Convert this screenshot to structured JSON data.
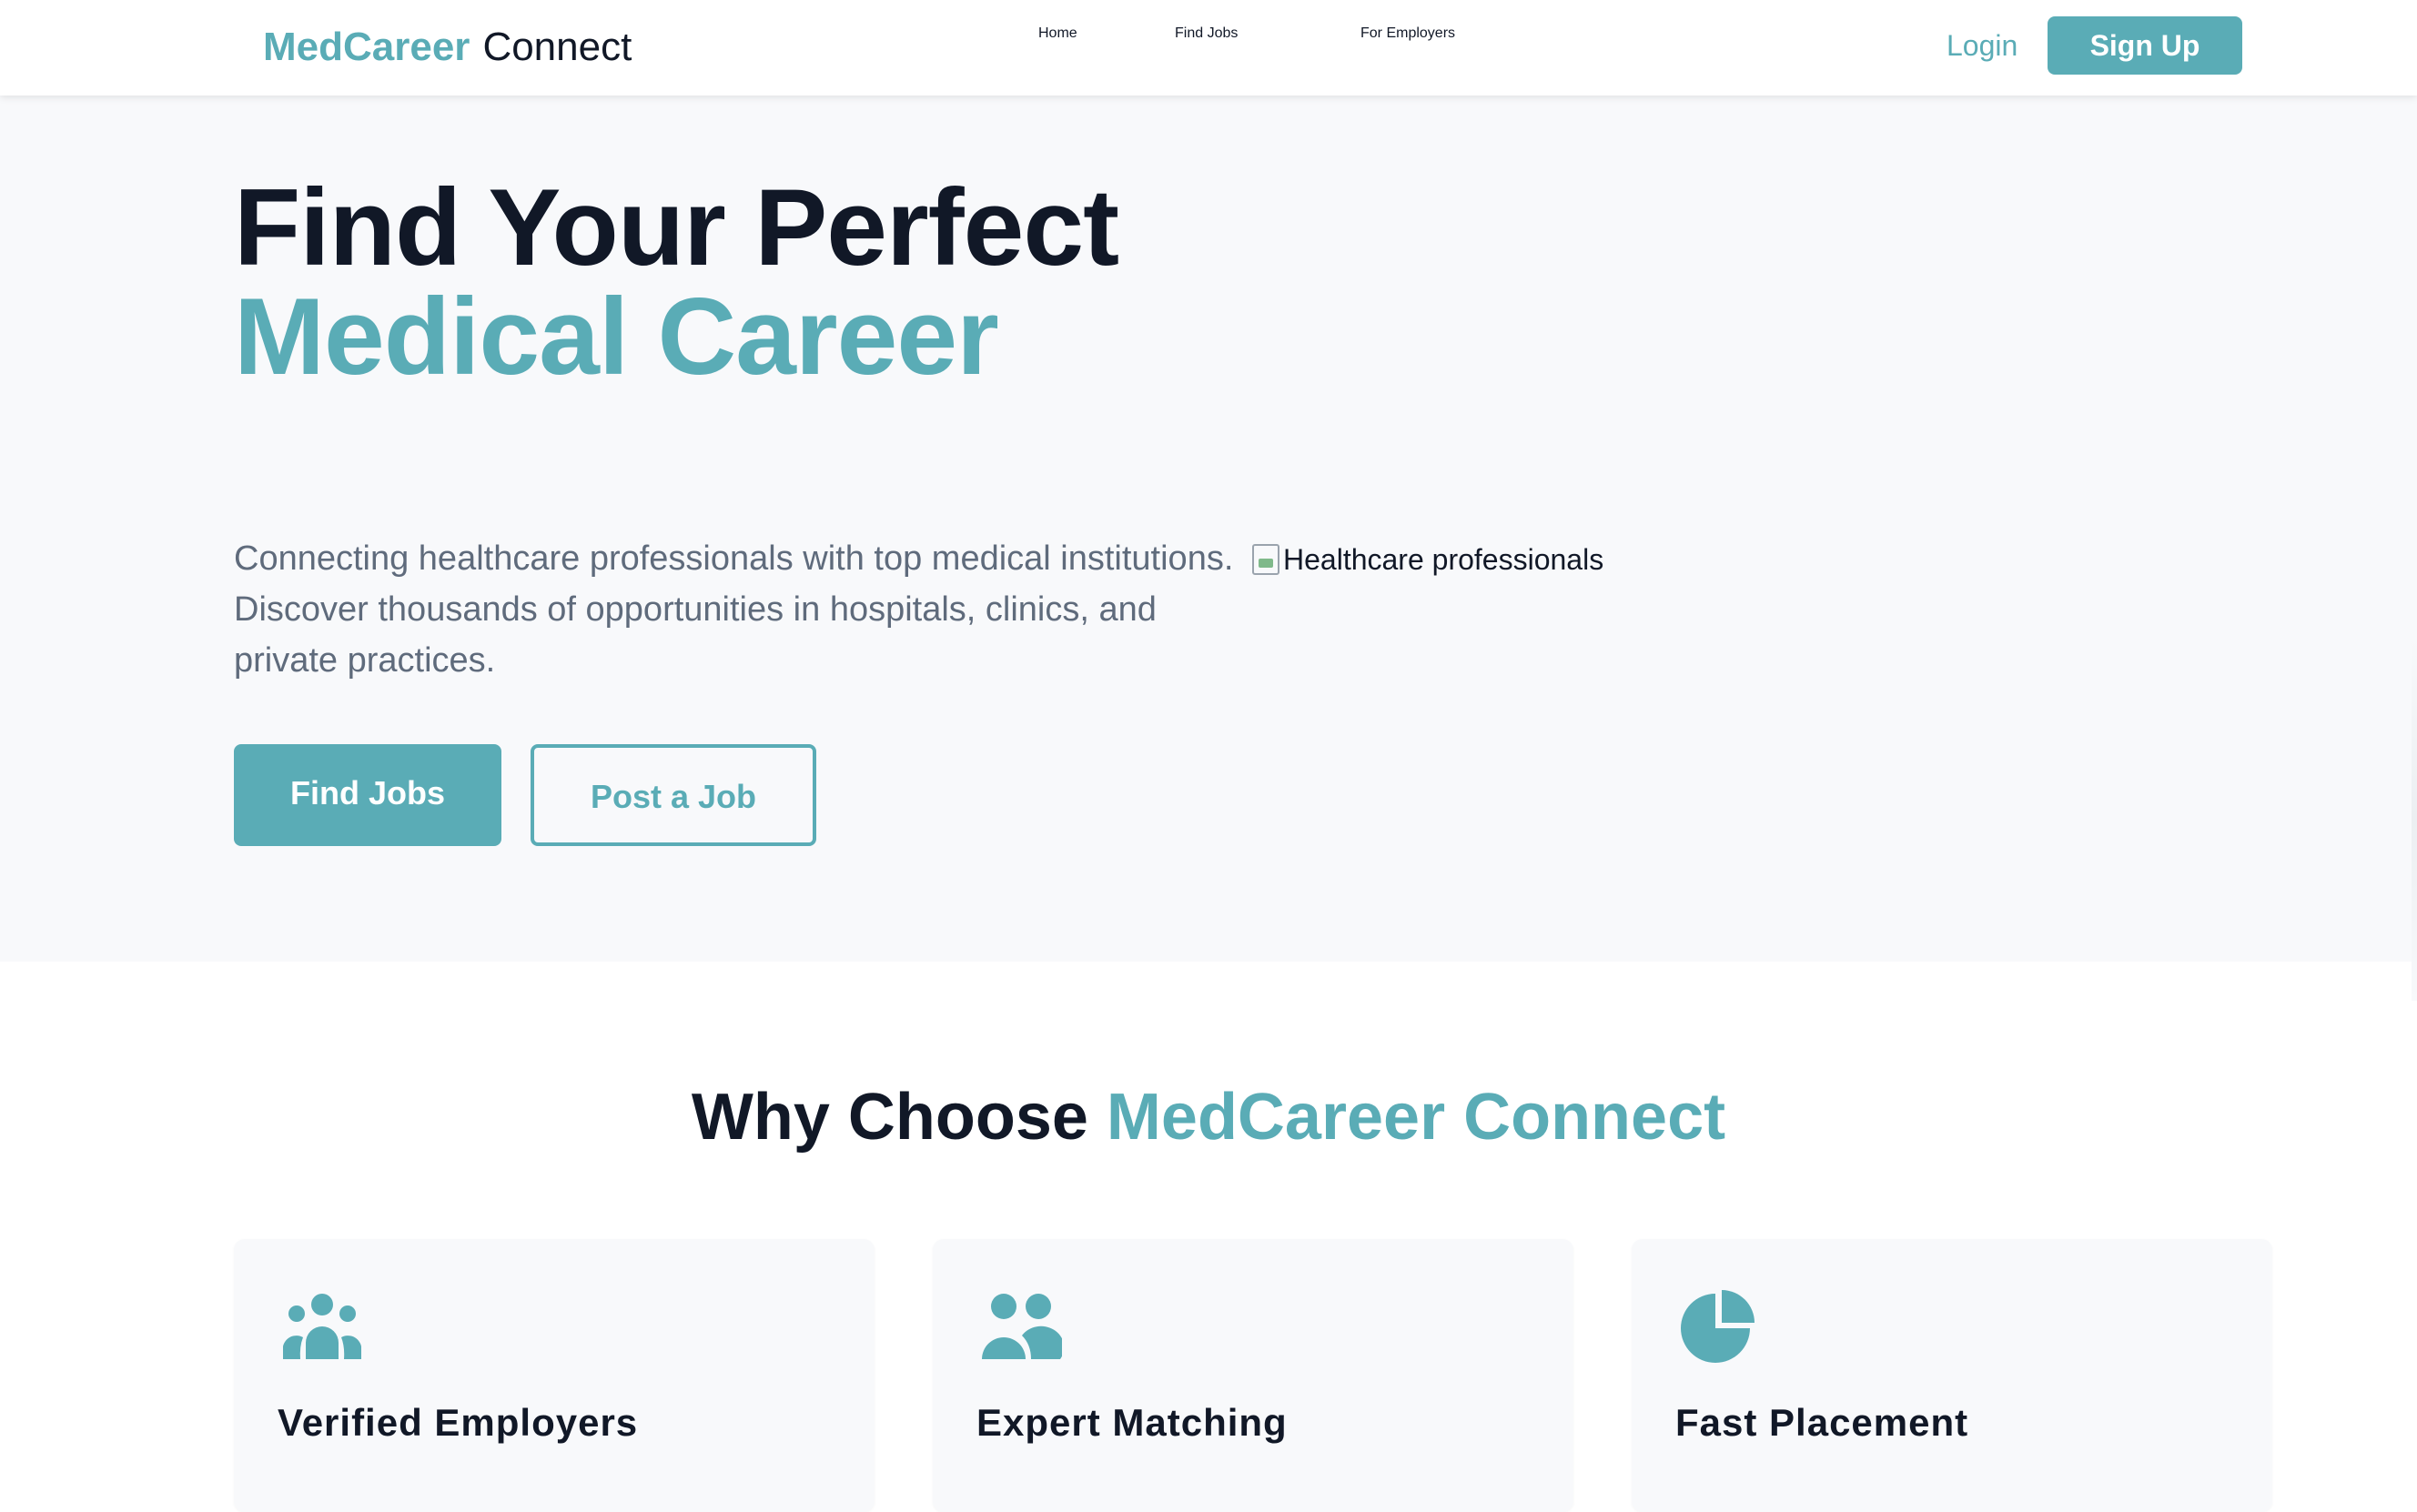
{
  "header": {
    "brand": "MedCareer",
    "brand_suffix": "Connect",
    "nav": [
      "Home",
      "Find Jobs",
      "For Employers"
    ],
    "login": "Login",
    "signup": "Sign Up"
  },
  "hero": {
    "title_line1": "Find Your Perfect",
    "title_line2": "Medical Career",
    "lead": "Connecting healthcare professionals with top medical institutions. Discover thousands of opportunities in hospitals, clinics, and private practices.",
    "primary_button": "Find Jobs",
    "secondary_button": "Post a Job",
    "image_alt": "Healthcare professionals"
  },
  "features": {
    "heading_prefix": "Why Choose",
    "heading_accent": "MedCareer Connect",
    "cards": [
      {
        "title": "Verified Employers",
        "icon": "group-icon"
      },
      {
        "title": "Expert Matching",
        "icon": "users-icon"
      },
      {
        "title": "Fast Placement",
        "icon": "pie-chart-icon"
      }
    ]
  },
  "colors": {
    "accent": "#5aacb6",
    "text": "#111827",
    "muted": "#5f6b7c",
    "hero_bg": "#f8f9fb"
  }
}
